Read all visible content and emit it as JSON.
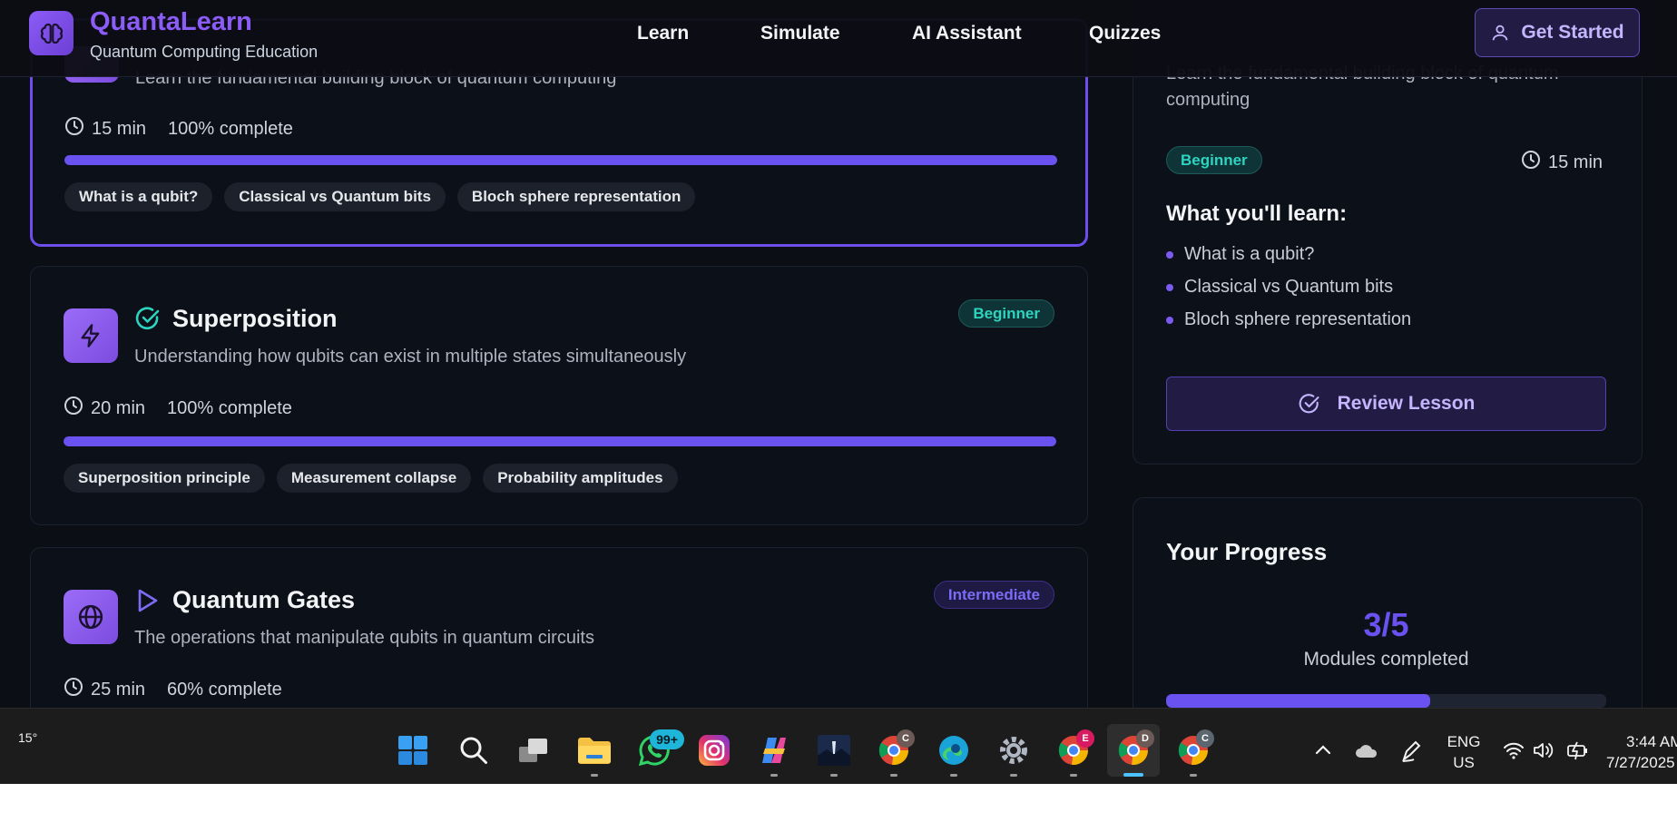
{
  "header": {
    "brand": "QuantaLearn",
    "subtitle": "Quantum Computing Education",
    "nav": [
      "Learn",
      "Simulate",
      "AI Assistant",
      "Quizzes"
    ],
    "cta": "Get Started"
  },
  "modules": [
    {
      "description": "Learn the fundamental building block of quantum computing",
      "duration": "15 min",
      "progress_text": "100% complete",
      "progress": 1.0,
      "tags": [
        "What is a qubit?",
        "Classical vs Quantum bits",
        "Bloch sphere representation"
      ]
    },
    {
      "title": "Superposition",
      "description": "Understanding how qubits can exist in multiple states simultaneously",
      "level": "Beginner",
      "duration": "20 min",
      "progress_text": "100% complete",
      "progress": 1.0,
      "tags": [
        "Superposition principle",
        "Measurement collapse",
        "Probability amplitudes"
      ]
    },
    {
      "title": "Quantum Gates",
      "description": "The operations that manipulate qubits in quantum circuits",
      "level": "Intermediate",
      "duration": "25 min",
      "progress_text": "60% complete",
      "progress": 0.6
    }
  ],
  "detail": {
    "description": "Learn the fundamental building block of quantum computing",
    "level": "Beginner",
    "duration": "15 min",
    "learn_heading": "What you'll learn:",
    "learn_items": [
      "What is a qubit?",
      "Classical vs Quantum bits",
      "Bloch sphere representation"
    ],
    "review_button": "Review Lesson"
  },
  "progress_panel": {
    "heading": "Your Progress",
    "count": "3/5",
    "caption": "Modules completed",
    "fraction": 0.6
  },
  "taskbar": {
    "weather_temp": "15°",
    "whatsapp_badge": "99+",
    "profile_badges": [
      "C",
      "E",
      "D",
      "C"
    ],
    "language": "ENG",
    "region": "US",
    "time": "3:44 AM",
    "date": "7/27/2025"
  },
  "colors": {
    "accent": "#6a52f0",
    "beginner": "#2dd4bf",
    "intermediate": "#7c6cf5"
  }
}
